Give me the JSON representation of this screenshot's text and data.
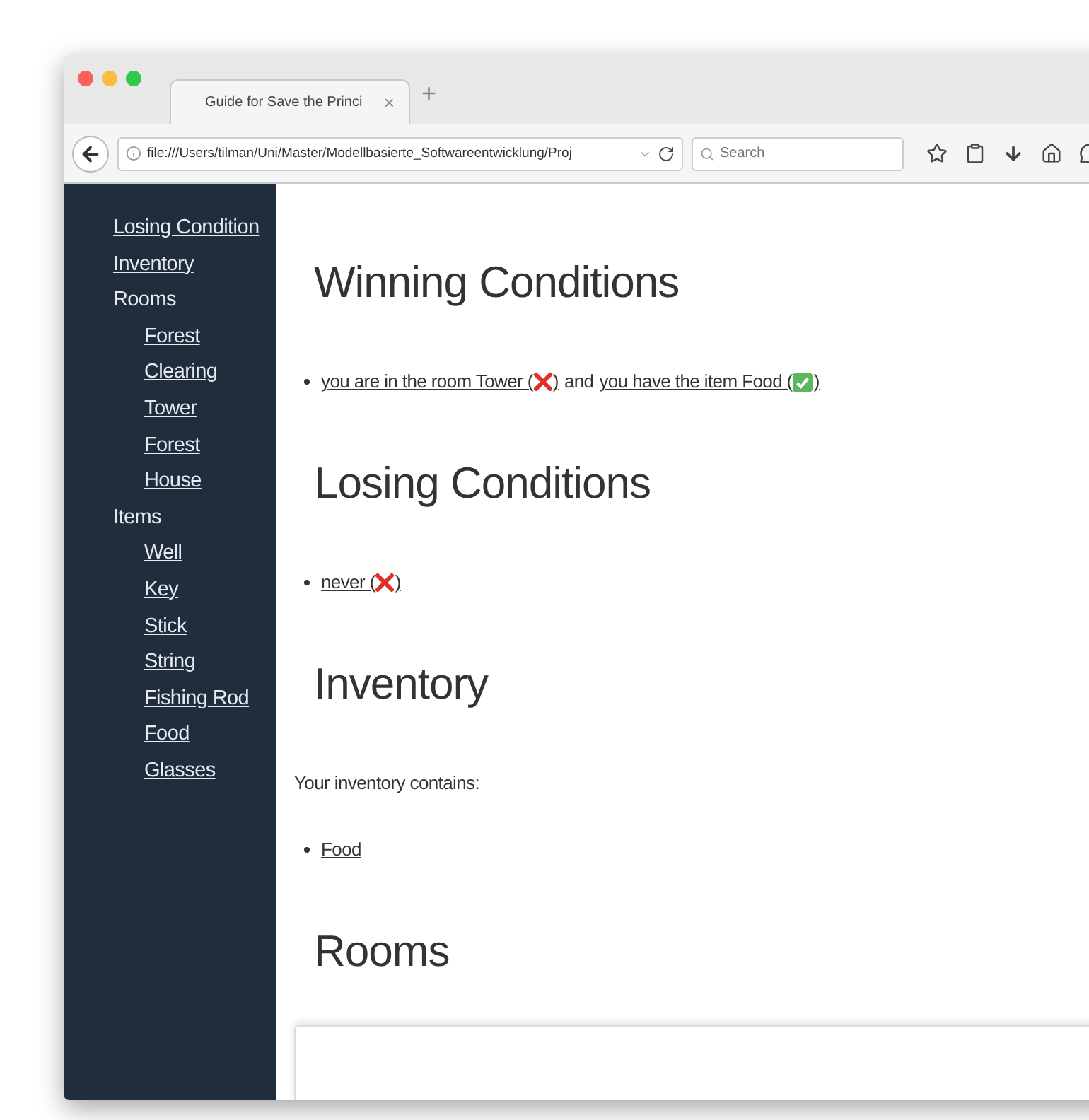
{
  "browser": {
    "tab": {
      "title": "Guide for Save the Princi",
      "close": "×"
    },
    "new_tab": "+",
    "address": "file:///Users/tilman/Uni/Master/Modellbasierte_Softwareentwicklung/Proj",
    "search": {
      "placeholder": "Search"
    }
  },
  "sidebar": {
    "items": [
      {
        "kind": "link",
        "label": "Losing Condition"
      },
      {
        "kind": "link",
        "label": "Inventory"
      },
      {
        "kind": "group",
        "label": "Rooms",
        "children": [
          {
            "kind": "link",
            "label": "Forest"
          },
          {
            "kind": "link",
            "label": "Clearing"
          },
          {
            "kind": "link",
            "label": "Tower"
          },
          {
            "kind": "link",
            "label": "Forest"
          },
          {
            "kind": "link",
            "label": "House"
          }
        ]
      },
      {
        "kind": "group",
        "label": "Items",
        "children": [
          {
            "kind": "link",
            "label": "Well"
          },
          {
            "kind": "link",
            "label": "Key"
          },
          {
            "kind": "link",
            "label": "Stick"
          },
          {
            "kind": "link",
            "label": "String"
          },
          {
            "kind": "link",
            "label": "Fishing Rod"
          },
          {
            "kind": "link",
            "label": "Food"
          },
          {
            "kind": "link",
            "label": "Glasses"
          }
        ]
      }
    ]
  },
  "sections": [
    {
      "kind": "conditions",
      "title": "Winning Conditions",
      "items": [
        {
          "parts": [
            {
              "kind": "link",
              "text": "you are in the room Tower (",
              "met": false,
              "close": ")"
            },
            {
              "kind": "text",
              "text": "and"
            },
            {
              "kind": "link",
              "text": "you have the item Food (",
              "met": true,
              "close": ")"
            }
          ]
        }
      ]
    },
    {
      "kind": "conditions",
      "title": "Losing Conditions",
      "items": [
        {
          "parts": [
            {
              "kind": "link",
              "text": "never (",
              "met": false,
              "close": ")"
            }
          ]
        }
      ]
    },
    {
      "kind": "list",
      "title": "Inventory",
      "intro": "Your inventory contains:",
      "items": [
        "Food"
      ]
    },
    {
      "kind": "cards",
      "title": "Rooms"
    }
  ]
}
